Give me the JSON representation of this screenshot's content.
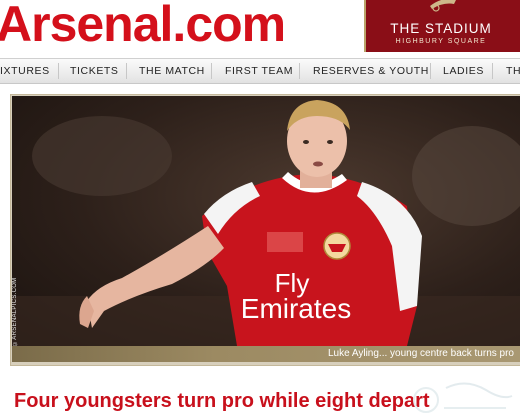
{
  "site": {
    "logo_text": "Arsenal.com"
  },
  "stadium_banner": {
    "title": "THE STADIUM",
    "subtitle": "HIGHBURY SQUARE"
  },
  "nav": {
    "items": [
      {
        "label": "IXTURES"
      },
      {
        "label": "TICKETS"
      },
      {
        "label": "THE MATCH"
      },
      {
        "label": "FIRST TEAM"
      },
      {
        "label": "RESERVES & YOUTH"
      },
      {
        "label": "LADIES"
      },
      {
        "label": "TH"
      }
    ]
  },
  "feature": {
    "photo_credit": "©ARSENALPICS.COM",
    "caption": "Luke Ayling... young centre back turns pro",
    "jersey_sponsor_line1": "Fly",
    "jersey_sponsor_line2": "Emirates"
  },
  "headline": "Four youngsters turn pro while eight depart",
  "colors": {
    "brand_red": "#d4101b",
    "stadium_maroon": "#8a0e17",
    "caption_gold": "#9c8a62"
  }
}
